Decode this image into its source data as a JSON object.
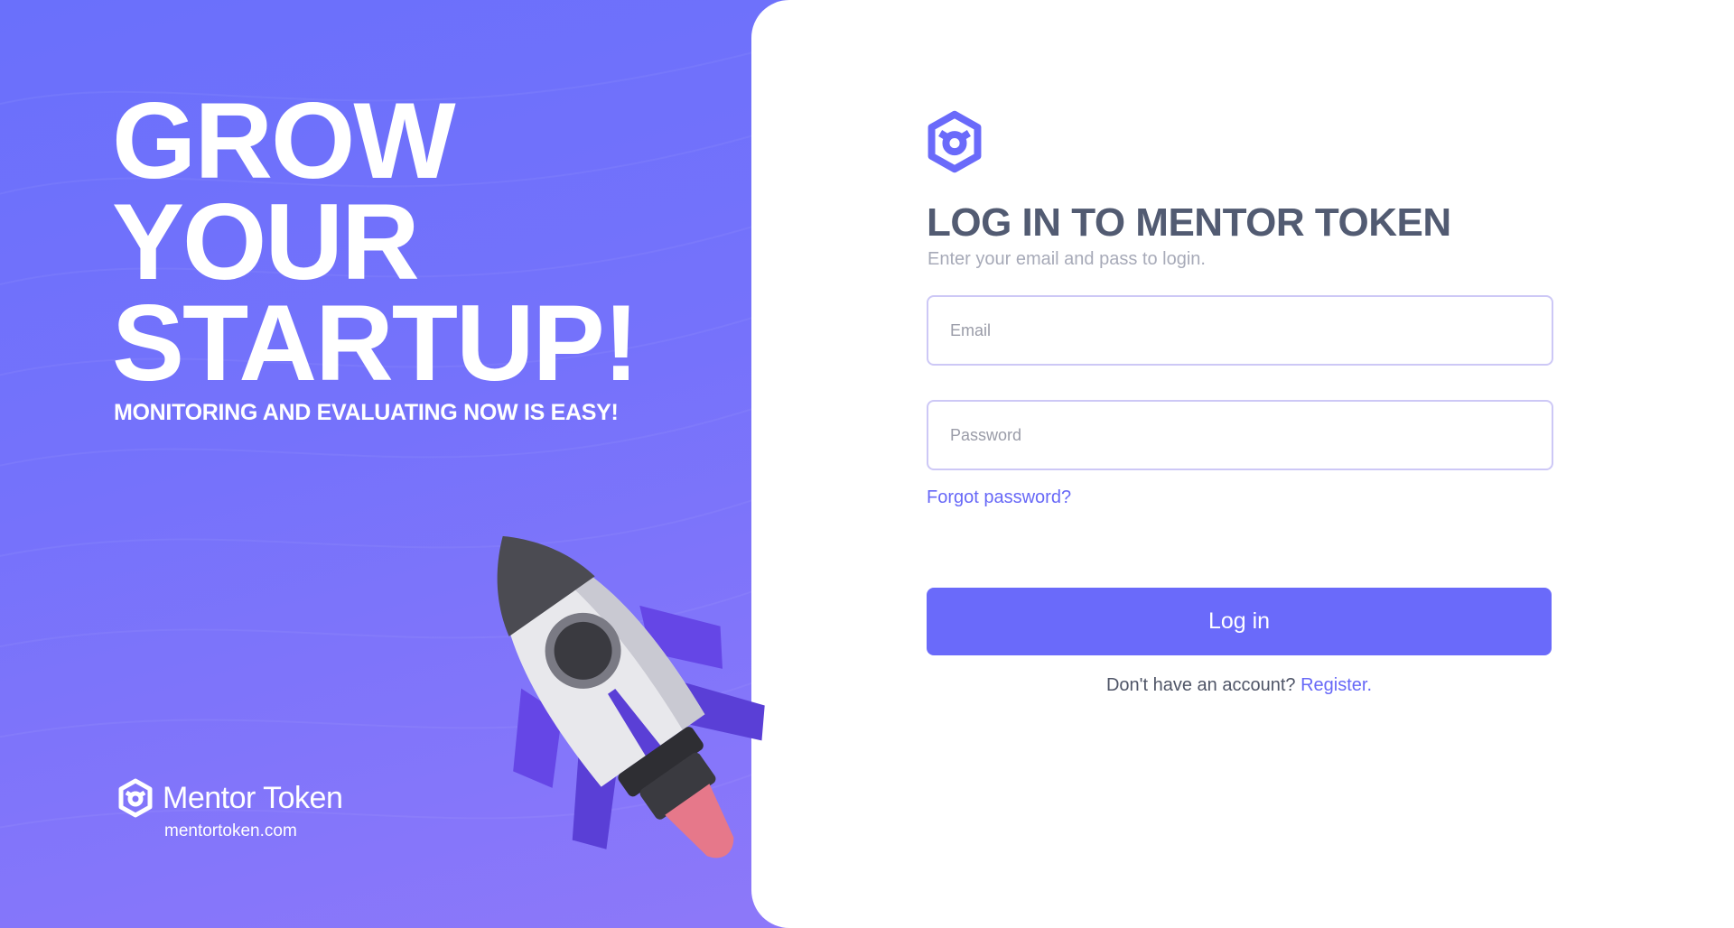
{
  "hero": {
    "title_lines": [
      "GROW",
      "YOUR",
      "STARTUP!"
    ],
    "subtitle": "MONITORING AND EVALUATING NOW IS EASY!",
    "brand_name": "Mentor Token",
    "brand_url": "mentortoken.com"
  },
  "login": {
    "title": "LOG IN TO MENTOR TOKEN",
    "subtitle": "Enter your email and pass to login.",
    "email_placeholder": "Email",
    "password_placeholder": "Password",
    "forgot_label": "Forgot password?",
    "button_label": "Log in",
    "register_prompt": "Don't have an account?",
    "register_link": "Register."
  },
  "colors": {
    "brand": "#6a6afa",
    "hero_bg": "#7068f8",
    "title_text": "#525b72",
    "link": "#6768f7"
  },
  "icons": {
    "logo": "hexagon-cube-icon"
  }
}
